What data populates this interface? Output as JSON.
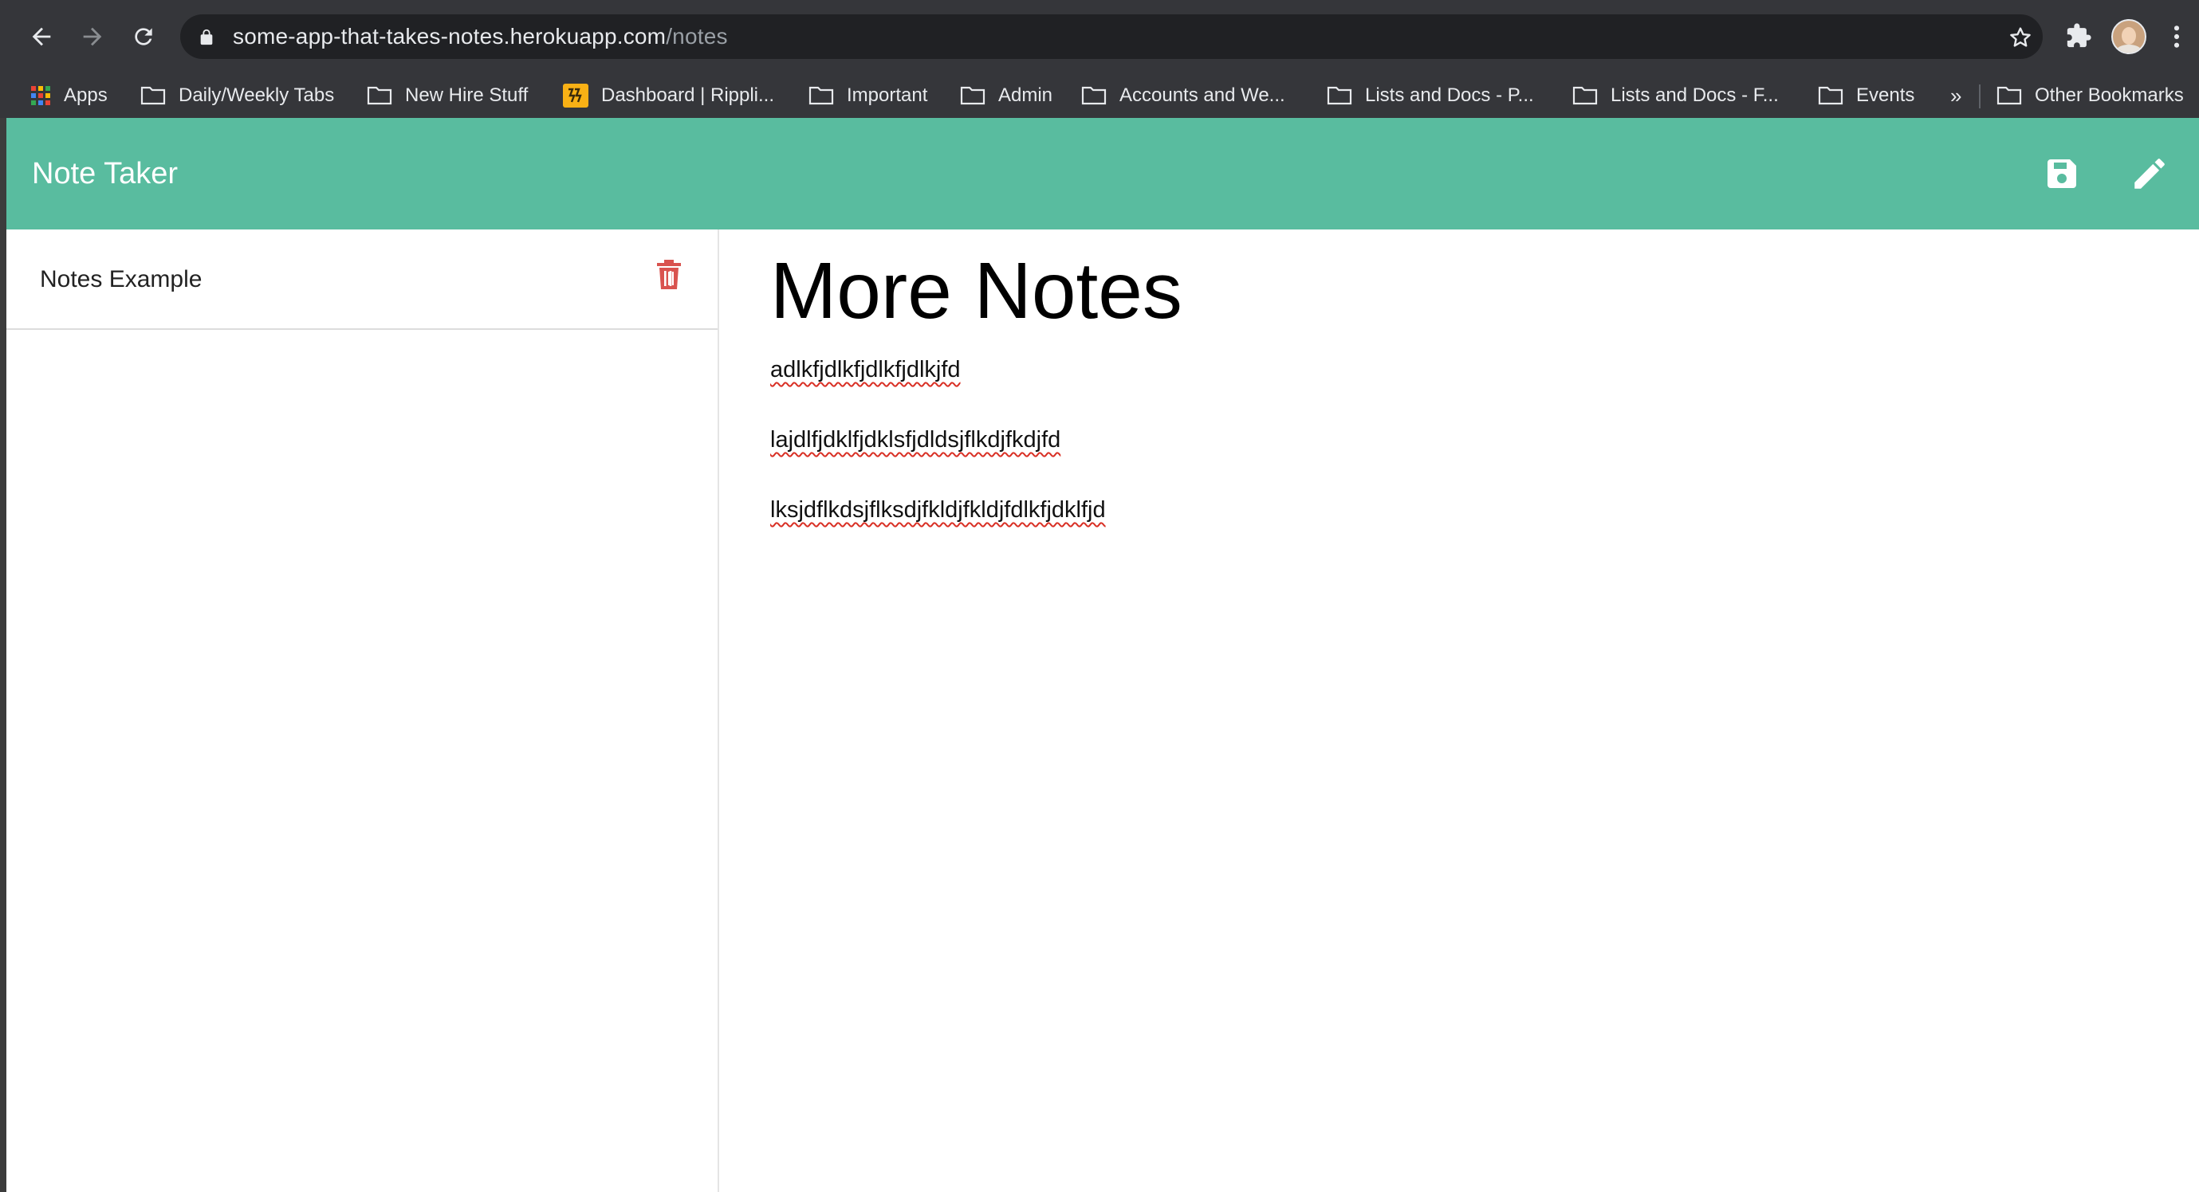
{
  "browser": {
    "url_host": "some-app-that-takes-notes.herokuapp.com",
    "url_path": "/notes",
    "bookmarks": [
      {
        "label": "Apps",
        "icon": "apps-grid-icon"
      },
      {
        "label": "Daily/Weekly Tabs",
        "icon": "folder-icon"
      },
      {
        "label": "New Hire Stuff",
        "icon": "folder-icon"
      },
      {
        "label": "Dashboard | Rippli...",
        "icon": "rippling-logo-icon"
      },
      {
        "label": "Important",
        "icon": "folder-icon"
      },
      {
        "label": "Admin",
        "icon": "folder-icon"
      },
      {
        "label": "Accounts and We...",
        "icon": "folder-icon"
      },
      {
        "label": "Lists and Docs - P...",
        "icon": "folder-icon"
      },
      {
        "label": "Lists and Docs - F...",
        "icon": "folder-icon"
      },
      {
        "label": "Events",
        "icon": "folder-icon"
      }
    ],
    "overflow_label": "»",
    "other_bookmarks": "Other Bookmarks"
  },
  "app": {
    "title": "Note Taker",
    "accent_color": "#59bc9f",
    "delete_color": "#d9534f"
  },
  "sidebar": {
    "notes": [
      {
        "title": "Notes Example"
      }
    ]
  },
  "editor": {
    "title": "More Notes",
    "lines": [
      "adlkfjdlkfjdlkfjdlkjfd",
      "lajdlfjdklfjdklsfjdldsjflkdjfkdjfd",
      "lksjdflkdsjflksdjfkldjfkldjfdlkfjdklfjd"
    ]
  }
}
